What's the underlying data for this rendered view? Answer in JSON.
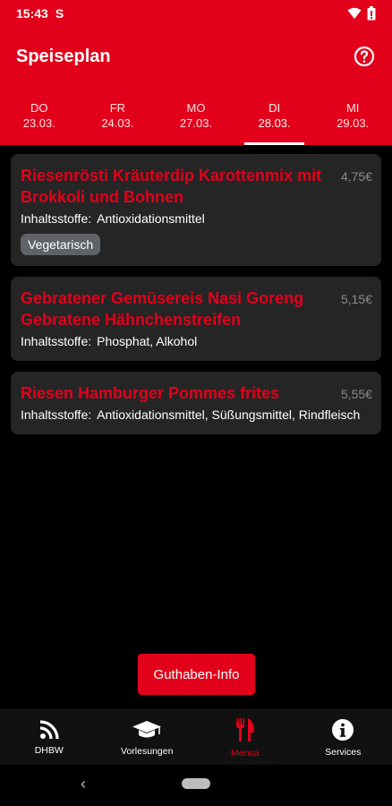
{
  "status_bar": {
    "time": "15:43",
    "app_indicator": "S",
    "icons": [
      "wifi-icon",
      "battery-icon"
    ]
  },
  "app_bar": {
    "title": "Speiseplan",
    "help_icon": "help-circle-icon"
  },
  "days": [
    {
      "dow": "DO",
      "date": "23.03.",
      "active": false
    },
    {
      "dow": "FR",
      "date": "24.03.",
      "active": false
    },
    {
      "dow": "MO",
      "date": "27.03.",
      "active": false
    },
    {
      "dow": "DI",
      "date": "28.03.",
      "active": true
    },
    {
      "dow": "MI",
      "date": "29.03.",
      "active": false
    }
  ],
  "meals": [
    {
      "title": "Riesenrösti Kräuterdip Karottenmix mit Brokkoli und Bohnen",
      "price": "4,75€",
      "ingredients_label": "Inhaltsstoffe:",
      "ingredients": "Antioxidationsmittel",
      "badge": "Vegetarisch"
    },
    {
      "title": "Gebratener Gemüsereis Nasi Goreng Gebratene Hähnchenstreifen",
      "price": "5,15€",
      "ingredients_label": "Inhaltsstoffe:",
      "ingredients": "Phosphat, Alkohol"
    },
    {
      "title": "Riesen Hamburger Pommes frites",
      "price": "5,55€",
      "ingredients_label": "Inhaltsstoffe:",
      "ingredients": "Antioxidationsmittel, Süßungsmittel, Rindfleisch"
    }
  ],
  "balance_button": {
    "label": "Guthaben-Info"
  },
  "bottom_nav": [
    {
      "label": "DHBW",
      "icon": "rss-feed-icon",
      "active": false
    },
    {
      "label": "Vorlesungen",
      "icon": "graduation-cap-icon",
      "active": false
    },
    {
      "label": "Mensa",
      "icon": "fork-knife-icon",
      "active": true
    },
    {
      "label": "Services",
      "icon": "info-circle-icon",
      "active": false
    }
  ],
  "colors": {
    "brand_red": "#e2001a",
    "card_bg": "#252525",
    "badge_bg": "#5f6368",
    "price_gray": "#8a8a8a"
  }
}
